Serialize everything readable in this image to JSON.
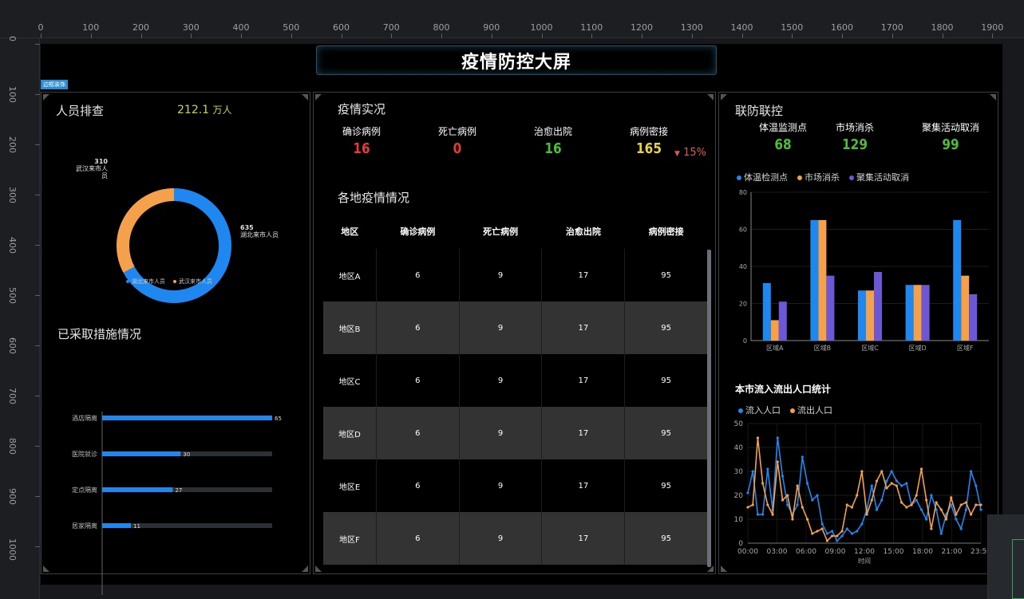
{
  "ruler": {
    "top": [
      "0",
      "100",
      "200",
      "300",
      "400",
      "500",
      "600",
      "700",
      "800",
      "900",
      "1000",
      "1100",
      "1200",
      "1300",
      "1400",
      "1500",
      "1600",
      "1700",
      "1800",
      "1900"
    ],
    "left": [
      "0",
      "100",
      "200",
      "300",
      "400",
      "500",
      "600",
      "700",
      "800",
      "900",
      "1000"
    ]
  },
  "header": {
    "title": "疫情防控大屏",
    "tag": "边框装饰"
  },
  "people": {
    "title": "人员排查",
    "total_value": "212.1",
    "total_unit": "万人",
    "donut": [
      {
        "name": "湖北来市人员",
        "value": 635,
        "color": "#1e88f0"
      },
      {
        "name": "武汉来市人员",
        "value": 310,
        "color": "#f5a04a"
      }
    ],
    "label_hubei_value": "635",
    "label_hubei_name": "湖北来市人员",
    "label_wuhan_value": "310",
    "label_wuhan_name": "武汉来市人员",
    "legend": [
      "湖北来市人员",
      "武汉来市人员"
    ]
  },
  "measures": {
    "title": "已采取措施情况",
    "items": [
      {
        "label": "酒店隔离",
        "value": 65
      },
      {
        "label": "医院就诊",
        "value": 30
      },
      {
        "label": "定点隔离",
        "value": 27
      },
      {
        "label": "居家隔离",
        "value": 11
      }
    ],
    "max": 65
  },
  "situation": {
    "title": "疫情实况",
    "stats": [
      {
        "label": "确诊病例",
        "value": "16",
        "color": "#e53a3a"
      },
      {
        "label": "死亡病例",
        "value": "0",
        "color": "#e53a3a"
      },
      {
        "label": "治愈出院",
        "value": "16",
        "color": "#4dbd3a"
      },
      {
        "label": "病例密接",
        "value": "165",
        "color": "#e8d23c"
      }
    ],
    "trend_arrow": "▼",
    "trend_value": "15%",
    "trend_color": "#e05a4e"
  },
  "regions": {
    "title": "各地疫情情况",
    "headers": [
      "地区",
      "确诊病例",
      "死亡病例",
      "治愈出院",
      "病例密接"
    ],
    "rows": [
      [
        "地区A",
        "6",
        "9",
        "17",
        "95"
      ],
      [
        "地区B",
        "6",
        "9",
        "17",
        "95"
      ],
      [
        "地区C",
        "6",
        "9",
        "17",
        "95"
      ],
      [
        "地区D",
        "6",
        "9",
        "17",
        "95"
      ],
      [
        "地区E",
        "6",
        "9",
        "17",
        "95"
      ],
      [
        "地区F",
        "6",
        "9",
        "17",
        "95"
      ]
    ]
  },
  "joint": {
    "title": "联防联控",
    "stats": [
      {
        "label": "体温监测点",
        "value": "68"
      },
      {
        "label": "市场消杀",
        "value": "129"
      },
      {
        "label": "聚集活动取消",
        "value": "99"
      }
    ],
    "legend": [
      "体温检测点",
      "市场消杀",
      "聚集活动取消"
    ]
  },
  "flow": {
    "title": "本市流入流出人口统计",
    "legend": [
      "流入人口",
      "流出人口"
    ],
    "xlabel": "时间"
  },
  "chart_data": [
    {
      "type": "bar",
      "categories": [
        "区域A",
        "区域B",
        "区域C",
        "区域D",
        "区域F"
      ],
      "series": [
        {
          "name": "体温检测点",
          "values": [
            31,
            65,
            27,
            30,
            65
          ],
          "color": "#1e88f0"
        },
        {
          "name": "市场消杀",
          "values": [
            11,
            65,
            27,
            30,
            35
          ],
          "color": "#f5a04a"
        },
        {
          "name": "聚集活动取消",
          "values": [
            21,
            35,
            37,
            30,
            25
          ],
          "color": "#6c58d6"
        }
      ],
      "ylim": [
        0,
        80
      ],
      "yticks": [
        "0",
        "20",
        "40",
        "60",
        "80"
      ],
      "legend": "top-left"
    },
    {
      "type": "line",
      "xticks": [
        "00:00",
        "03:00",
        "06:00",
        "09:00",
        "12:00",
        "15:00",
        "18:00",
        "21:00",
        "23:50"
      ],
      "xlabel": "时间",
      "ylim": [
        0,
        50
      ],
      "yticks": [
        "0",
        "10",
        "20",
        "30",
        "40",
        "50"
      ],
      "series": [
        {
          "name": "流入人口",
          "color": "#1e88f0",
          "values": [
            21,
            30,
            12,
            12,
            31,
            14,
            44,
            28,
            16,
            12,
            16,
            36,
            25,
            18,
            20,
            8,
            4,
            5,
            1,
            3,
            6,
            4,
            5,
            8,
            14,
            24,
            14,
            18,
            26,
            30,
            26,
            24,
            25,
            16,
            18,
            14,
            10,
            20,
            14,
            4,
            12,
            16,
            10,
            6,
            14,
            30,
            24,
            14
          ]
        },
        {
          "name": "流出人口",
          "color": "#f5a04a",
          "values": [
            15,
            16,
            44,
            25,
            16,
            12,
            34,
            18,
            20,
            10,
            24,
            15,
            10,
            4,
            5,
            6,
            1,
            3,
            3,
            5,
            16,
            15,
            20,
            30,
            12,
            18,
            26,
            30,
            23,
            25,
            24,
            17,
            15,
            16,
            20,
            31,
            18,
            6,
            17,
            14,
            10,
            19,
            12,
            16,
            17,
            12,
            16,
            16
          ]
        }
      ],
      "legend": "top-left"
    }
  ]
}
